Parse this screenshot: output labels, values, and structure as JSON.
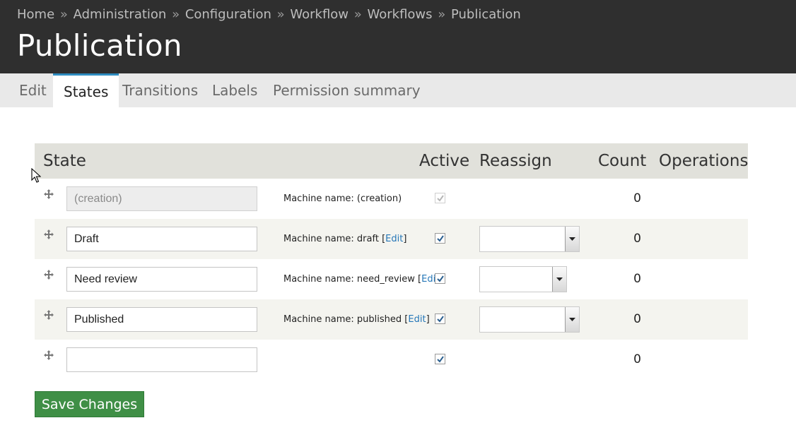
{
  "breadcrumb": {
    "items": [
      "Home",
      "Administration",
      "Configuration",
      "Workflow",
      "Workflows",
      "Publication"
    ],
    "separator": "»"
  },
  "page": {
    "title": "Publication"
  },
  "tabs": [
    {
      "label": "Edit"
    },
    {
      "label": "States",
      "active": true
    },
    {
      "label": "Transitions"
    },
    {
      "label": "Labels"
    },
    {
      "label": "Permission summary"
    }
  ],
  "table": {
    "headers": {
      "state": "State",
      "active": "Active",
      "reassign": "Reassign",
      "count": "Count",
      "operations": "Operations"
    },
    "rows": [
      {
        "name": "(creation)",
        "machine_prefix": "Machine name: (creation)",
        "edit": "",
        "active": true,
        "active_disabled": true,
        "reassign": null,
        "count": "0"
      },
      {
        "name": "Draft",
        "machine_prefix": "Machine name: draft [",
        "edit": "Edit",
        "machine_suffix": "]",
        "active": true,
        "reassign": "",
        "count": "0"
      },
      {
        "name": "Need review",
        "machine_prefix": "Machine name: need_review [",
        "edit": "Edit",
        "machine_suffix": "]",
        "active": true,
        "reassign": "",
        "count": "0"
      },
      {
        "name": "Published",
        "machine_prefix": "Machine name: published [",
        "edit": "Edit",
        "machine_suffix": "]",
        "active": true,
        "reassign": "",
        "count": "0"
      },
      {
        "name": "",
        "machine_prefix": "",
        "edit": "",
        "active": true,
        "reassign": null,
        "count": "0"
      }
    ]
  },
  "actions": {
    "save_label": "Save Changes"
  },
  "colors": {
    "header_bg": "#2f2f2f",
    "tab_active_border": "#2f8cc0",
    "save_button": "#3f8f46",
    "link": "#2677b8"
  },
  "icons": [
    "drag-handle-icon",
    "checkmark-icon",
    "dropdown-arrow-icon",
    "mouse-cursor-icon"
  ]
}
